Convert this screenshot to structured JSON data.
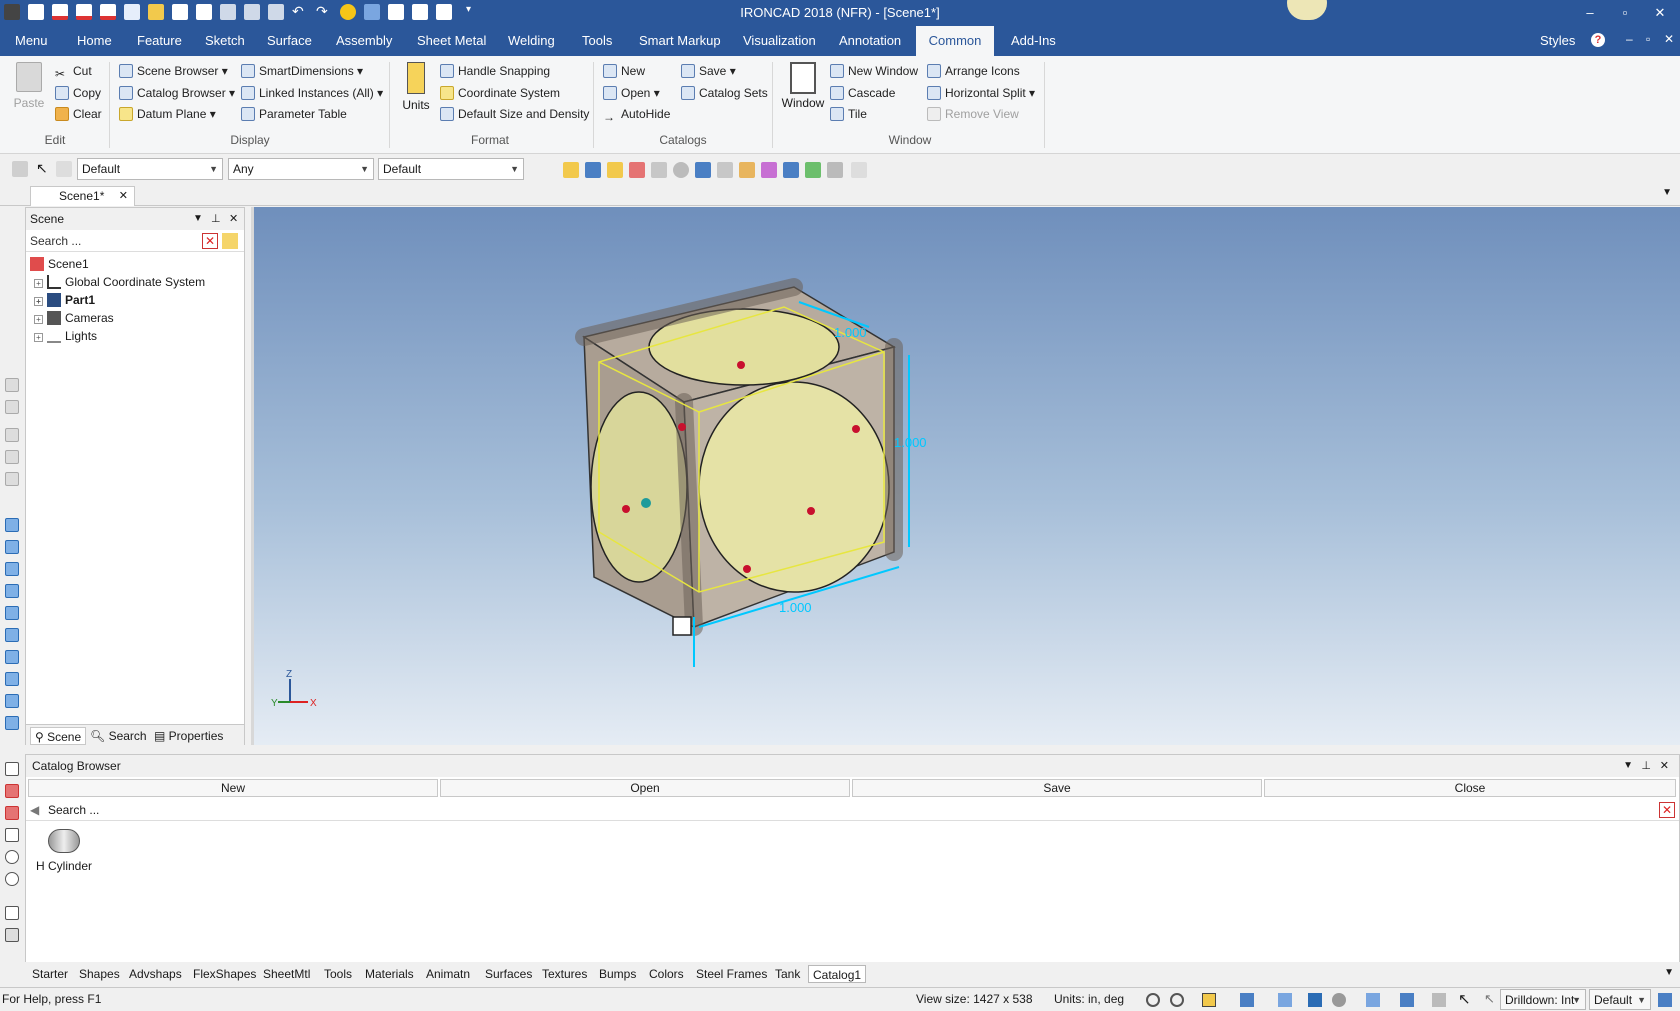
{
  "window": {
    "title": "IRONCAD 2018 (NFR) - [Scene1*]",
    "minimize": "–",
    "restore": "▫",
    "close": "✕"
  },
  "ribbon_tabs": [
    "Menu",
    "Home",
    "Feature",
    "Sketch",
    "Surface",
    "Assembly",
    "Sheet Metal",
    "Welding",
    "Tools",
    "Smart Markup",
    "Visualization",
    "Annotation",
    "Common",
    "Add-Ins"
  ],
  "active_tab": "Common",
  "styles_label": "Styles",
  "ribbon": {
    "edit": {
      "paste": "Paste",
      "cut": "Cut",
      "copy": "Copy",
      "clear": "Clear",
      "label": "Edit"
    },
    "display": {
      "scene_browser": "Scene Browser",
      "catalog_browser": "Catalog Browser",
      "datum_plane": "Datum Plane",
      "smart_dimensions": "SmartDimensions",
      "linked_instances": "Linked Instances (All)",
      "parameter_table": "Parameter Table",
      "label": "Display"
    },
    "format": {
      "units": "Units",
      "handle_snapping": "Handle Snapping",
      "coordinate_system": "Coordinate System",
      "default_size": "Default Size and Density",
      "label": "Format"
    },
    "catalogs": {
      "new": "New",
      "open": "Open",
      "autohide": "AutoHide",
      "save": "Save",
      "catalog_sets": "Catalog Sets",
      "label": "Catalogs"
    },
    "window": {
      "window": "Window",
      "new_window": "New Window",
      "cascade": "Cascade",
      "tile": "Tile",
      "arrange_icons": "Arrange Icons",
      "horizontal_split": "Horizontal Split",
      "remove_view": "Remove View",
      "label": "Window"
    }
  },
  "toolbar": {
    "combo1": "Default",
    "combo2": "Any",
    "combo3": "Default"
  },
  "doc_tab": "Scene1*",
  "scene_panel": {
    "title": "Scene",
    "search_placeholder": "Search ...",
    "tree": [
      "Scene1",
      "Global Coordinate System",
      "Part1",
      "Cameras",
      "Lights"
    ],
    "tabs": [
      "Scene",
      "Search",
      "Properties"
    ]
  },
  "viewport": {
    "dim_top": "1.000",
    "dim_right": "1.000",
    "dim_bottom": "1.000",
    "axis_z": "Z",
    "axis_y": "Y",
    "axis_x": "X"
  },
  "catalog_browser": {
    "title": "Catalog Browser",
    "new": "New",
    "open": "Open",
    "save": "Save",
    "close": "Close",
    "search_placeholder": "Search ...",
    "item": "H Cylinder",
    "tabs": [
      "Starter",
      "Shapes",
      "Advshaps",
      "FlexShapes",
      "SheetMtl",
      "Tools",
      "Materials",
      "Animatn",
      "Surfaces",
      "Textures",
      "Bumps",
      "Colors",
      "Steel Frames",
      "Tank",
      "Catalog1"
    ],
    "active_tab": "Catalog1"
  },
  "statusbar": {
    "help": "For Help, press F1",
    "view_size": "View size: 1427 x  538",
    "units": "Units: in, deg",
    "drilldown": "Drilldown: Int",
    "default": "Default"
  },
  "colors": {
    "titlebar": "#2b579a",
    "accent": "#2b579a",
    "shape": "#b3a89b",
    "shape_inner": "#e5e0a0",
    "dimension": "#00c8ff"
  }
}
